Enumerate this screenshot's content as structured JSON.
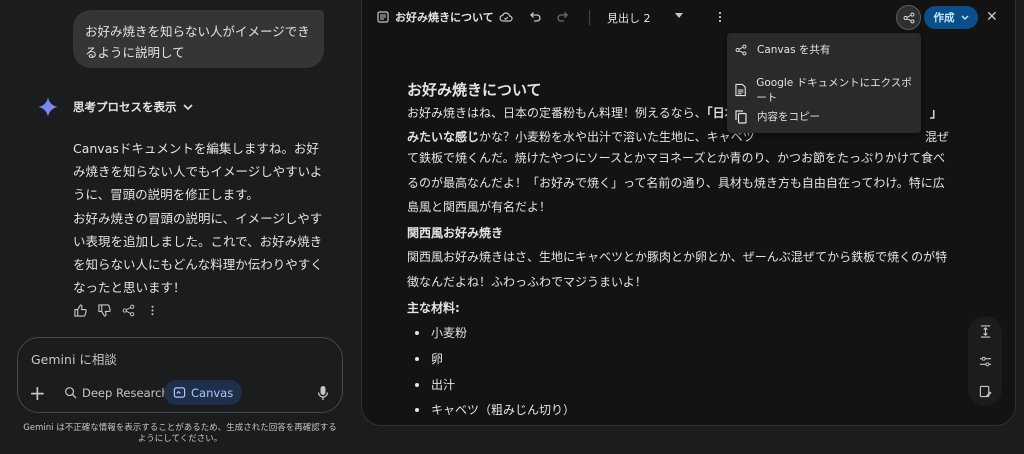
{
  "chat": {
    "user_message": "お好み焼きを知らない人がイメージできるように説明して",
    "thinking_label": "思考プロセスを表示",
    "response_p1": "Canvasドキュメントを編集しますね。お好み焼きを知らない人でもイメージしやすいように、冒頭の説明を修正します。",
    "response_p2": "お好み焼きの冒頭の説明に、イメージしやすい表現を追加しました。これで、お好み焼きを知らない人にもどんな料理か伝わりやすくなったと思います！"
  },
  "input": {
    "placeholder": "Gemini に相談",
    "chip_deep_research": "Deep Research",
    "chip_canvas": "Canvas"
  },
  "disclaimer": "Gemini は不正確な情報を表示することがあるため、生成された回答を再確認するようにしてください。",
  "canvas": {
    "doc_title": "お好み焼きについて",
    "heading_select": "見出し 2",
    "create_label": "作成",
    "h1": "お好み焼きについて",
    "intro_start": "お好み焼きはね、日本の定番粉もん料理！例えるなら、",
    "intro_bold_a": "「日本の",
    "intro_bold_b": "」",
    "intro_line2_bold": "みたいな感じ",
    "intro_line2_rest": "かな？小麦粉を水や出汁で溶いた生地に、キャベツ",
    "intro_line2_end": "混ぜ",
    "intro_rest": "て鉄板で焼くんだ。焼けたやつにソースとかマヨネーズとか青のり、かつお節をたっぷりかけて食べるのが最高なんだよ！「お好みで焼く」って名前の通り、具材も焼き方も自由自在ってわけ。特に広島風と関西風が有名だよ！",
    "section_title": "関西風お好み焼き",
    "section_text": "関西風お好み焼きはさ、生地にキャベツとか豚肉とか卵とか、ぜーんぶ混ぜてから鉄板で焼くのが特徴なんだよね！ふわっふわでマジうまいよ！",
    "ingredients_title": "主な材料:",
    "ingredients": [
      "小麦粉",
      "卵",
      "出汁",
      "キャベツ（粗みじん切り）"
    ]
  },
  "menu": {
    "share": "Canvas を共有",
    "export": "Google ドキュメントにエクスポート",
    "copy": "内容をコピー"
  }
}
